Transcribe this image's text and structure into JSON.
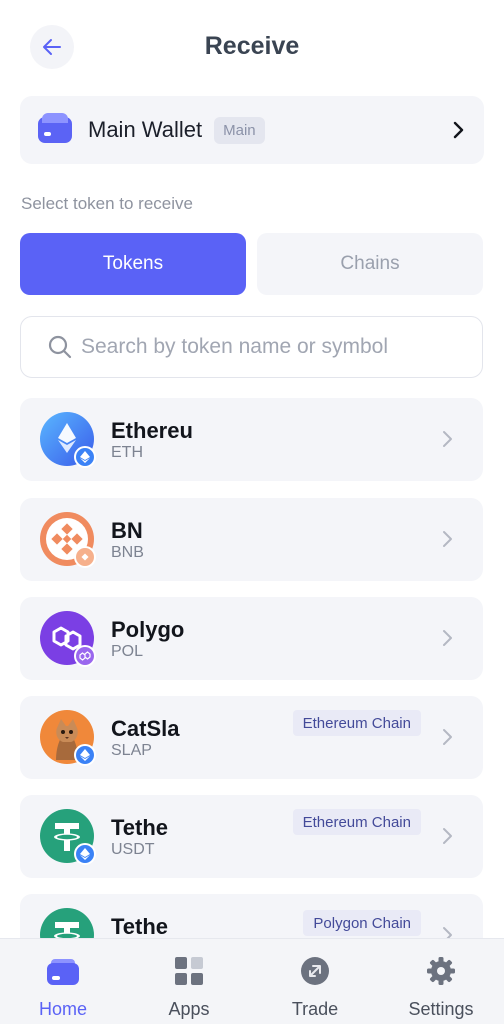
{
  "header": {
    "title": "Receive"
  },
  "wallet": {
    "name": "Main Wallet",
    "badge": "Main"
  },
  "section_label": "Select token to receive",
  "tabs": [
    {
      "label": "Tokens",
      "selected": true
    },
    {
      "label": "Chains",
      "selected": false
    }
  ],
  "search": {
    "placeholder": "Search by token name or symbol",
    "value": ""
  },
  "tokens": [
    {
      "name": "Ethereu",
      "symbol": "ETH",
      "icon": "ethereum-logo",
      "chain_tag": ""
    },
    {
      "name": "BN",
      "symbol": "BNB",
      "icon": "bnb-logo",
      "chain_tag": ""
    },
    {
      "name": "Polygo",
      "symbol": "POL",
      "icon": "polygon-logo",
      "chain_tag": ""
    },
    {
      "name": "CatSla",
      "symbol": "SLAP",
      "icon": "catslap-logo",
      "chain_tag": "Ethereum Chain"
    },
    {
      "name": "Tethe",
      "symbol": "USDT",
      "icon": "tether-logo",
      "chain_tag": "Ethereum Chain"
    },
    {
      "name": "Tethe",
      "symbol": "",
      "icon": "tether-logo",
      "chain_tag": "Polygon Chain"
    }
  ],
  "nav": [
    {
      "label": "Home",
      "icon": "wallet-icon",
      "active": true
    },
    {
      "label": "Apps",
      "icon": "apps-grid-icon",
      "active": false
    },
    {
      "label": "Trade",
      "icon": "trade-icon",
      "active": false
    },
    {
      "label": "Settings",
      "icon": "gear-icon",
      "active": false
    }
  ],
  "colors": {
    "accent": "#5a62f6",
    "surface": "#f4f5f9",
    "chain_tag_bg": "#e9eaf6",
    "chain_tag_text": "#434a99"
  }
}
